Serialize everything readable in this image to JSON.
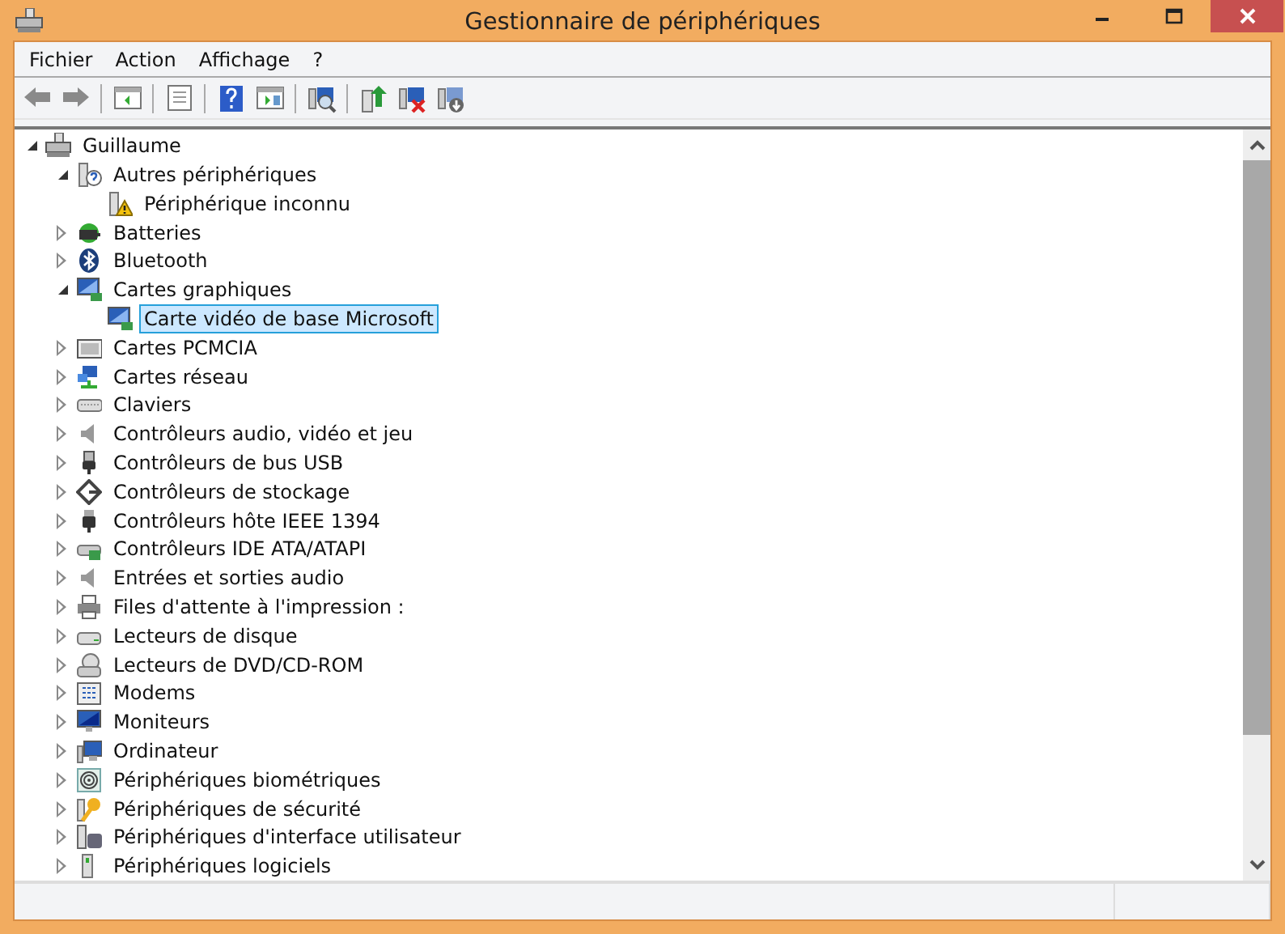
{
  "window": {
    "title": "Gestionnaire de périphériques"
  },
  "menu": [
    {
      "label": "Fichier"
    },
    {
      "label": "Action"
    },
    {
      "label": "Affichage"
    },
    {
      "label": "?"
    }
  ],
  "tree": {
    "label": "Guillaume",
    "expanded": true,
    "selected": false,
    "children": [
      {
        "label": "Autres périphériques",
        "expanded": true,
        "selected": false,
        "children": [
          {
            "label": "Périphérique inconnu",
            "selected": false
          }
        ]
      },
      {
        "label": "Batteries",
        "expanded": false,
        "selected": false
      },
      {
        "label": "Bluetooth",
        "expanded": false,
        "selected": false
      },
      {
        "label": "Cartes graphiques",
        "expanded": true,
        "selected": false,
        "children": [
          {
            "label": "Carte vidéo de base Microsoft",
            "selected": true
          }
        ]
      },
      {
        "label": "Cartes PCMCIA",
        "expanded": false,
        "selected": false
      },
      {
        "label": "Cartes réseau",
        "expanded": false,
        "selected": false
      },
      {
        "label": "Claviers",
        "expanded": false,
        "selected": false
      },
      {
        "label": "Contrôleurs audio, vidéo et jeu",
        "expanded": false,
        "selected": false
      },
      {
        "label": "Contrôleurs de bus USB",
        "expanded": false,
        "selected": false
      },
      {
        "label": "Contrôleurs de stockage",
        "expanded": false,
        "selected": false
      },
      {
        "label": "Contrôleurs hôte IEEE 1394",
        "expanded": false,
        "selected": false
      },
      {
        "label": "Contrôleurs IDE ATA/ATAPI",
        "expanded": false,
        "selected": false
      },
      {
        "label": "Entrées et sorties audio",
        "expanded": false,
        "selected": false
      },
      {
        "label": "Files d'attente à l'impression :",
        "expanded": false,
        "selected": false
      },
      {
        "label": "Lecteurs de disque",
        "expanded": false,
        "selected": false
      },
      {
        "label": "Lecteurs de DVD/CD-ROM",
        "expanded": false,
        "selected": false
      },
      {
        "label": "Modems",
        "expanded": false,
        "selected": false
      },
      {
        "label": "Moniteurs",
        "expanded": false,
        "selected": false
      },
      {
        "label": "Ordinateur",
        "expanded": false,
        "selected": false
      },
      {
        "label": "Périphériques biométriques",
        "expanded": false,
        "selected": false
      },
      {
        "label": "Périphériques de sécurité",
        "expanded": false,
        "selected": false
      },
      {
        "label": "Périphériques d'interface utilisateur",
        "expanded": false,
        "selected": false
      },
      {
        "label": "Périphériques logiciels",
        "expanded": false,
        "selected": false
      }
    ]
  }
}
